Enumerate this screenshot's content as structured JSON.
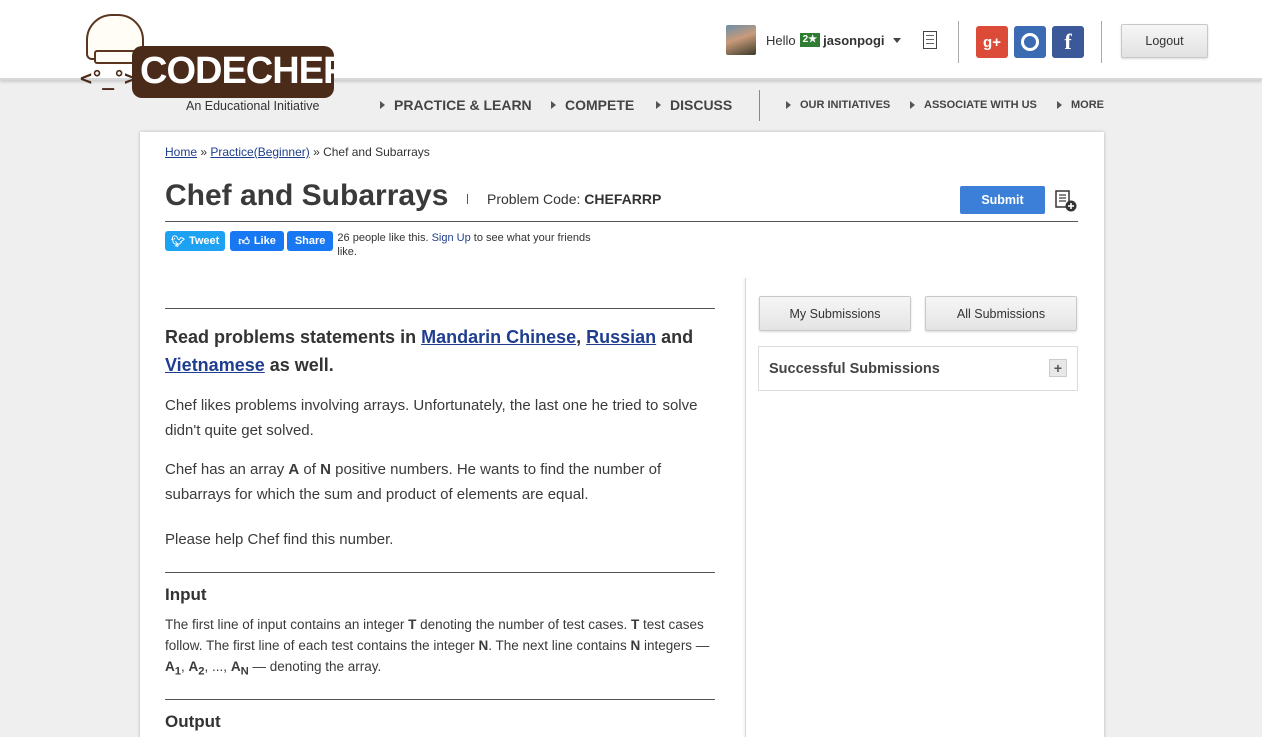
{
  "header": {
    "logo": {
      "brand": "CODECHEF",
      "tagline": "An Educational Initiative",
      "face": "<°_°>"
    },
    "user": {
      "greeting": "Hello",
      "rating": "2★",
      "username": "jasonpogi"
    },
    "social": {
      "gplus": "g+",
      "facebook": "f"
    },
    "logout_label": "Logout"
  },
  "nav": {
    "primary": [
      "PRACTICE & LEARN",
      "COMPETE",
      "DISCUSS"
    ],
    "secondary": [
      "OUR INITIATIVES",
      "ASSOCIATE WITH US",
      "MORE"
    ]
  },
  "breadcrumb": {
    "home": "Home",
    "sep1": " » ",
    "practice": "Practice(Beginner)",
    "sep2": " » ",
    "current": "Chef and Subarrays"
  },
  "problem": {
    "title": "Chef and Subarrays",
    "code_label": "Problem Code: ",
    "code": "CHEFARRP",
    "submit_label": "Submit"
  },
  "share": {
    "tweet": "Tweet",
    "like": "Like",
    "share": "Share",
    "likes_prefix": "26 people like this. ",
    "signup": "Sign Up",
    "likes_suffix": " to see what your friends like."
  },
  "statement": {
    "lang_prefix": "Read problems statements in ",
    "lang1": "Mandarin Chinese",
    "lang_sep": ", ",
    "lang2": "Russian",
    "lang_and": " and ",
    "lang3": "Vietnamese",
    "lang_suffix": " as well.",
    "p1": "Chef likes problems involving arrays. Unfortunately, the last one he tried to solve didn't quite get solved.",
    "p2_a": "Chef has an array ",
    "p2_A": "A",
    "p2_b": " of ",
    "p2_N": "N",
    "p2_c": " positive numbers. He wants to find the number of subarrays for which the sum and product of elements are equal.",
    "p3": "Please help Chef find this number.",
    "input_heading": "Input",
    "input_a": "The first line of input contains an integer ",
    "input_T1": "T",
    "input_b": " denoting the number of test cases. ",
    "input_T2": "T",
    "input_c": " test cases follow. The first line of each test contains the integer ",
    "input_N1": "N",
    "input_d": ". The next line contains ",
    "input_N2": "N",
    "input_e": " integers — ",
    "input_A1": "A",
    "input_sub1": "1",
    "input_f": ", ",
    "input_A2": "A",
    "input_sub2": "2",
    "input_g": ", ..., ",
    "input_AN": "A",
    "input_subN": "N",
    "input_h": " — denoting the array.",
    "output_heading": "Output"
  },
  "sidebar": {
    "my_submissions": "My Submissions",
    "all_submissions": "All Submissions",
    "successful_title": "Successful Submissions",
    "expand": "+"
  },
  "colors": {
    "link": "#1f3e8f",
    "submit_bg": "#3b7fd9",
    "brand_brown": "#4a2a18",
    "rating_green": "#2e7d32"
  }
}
